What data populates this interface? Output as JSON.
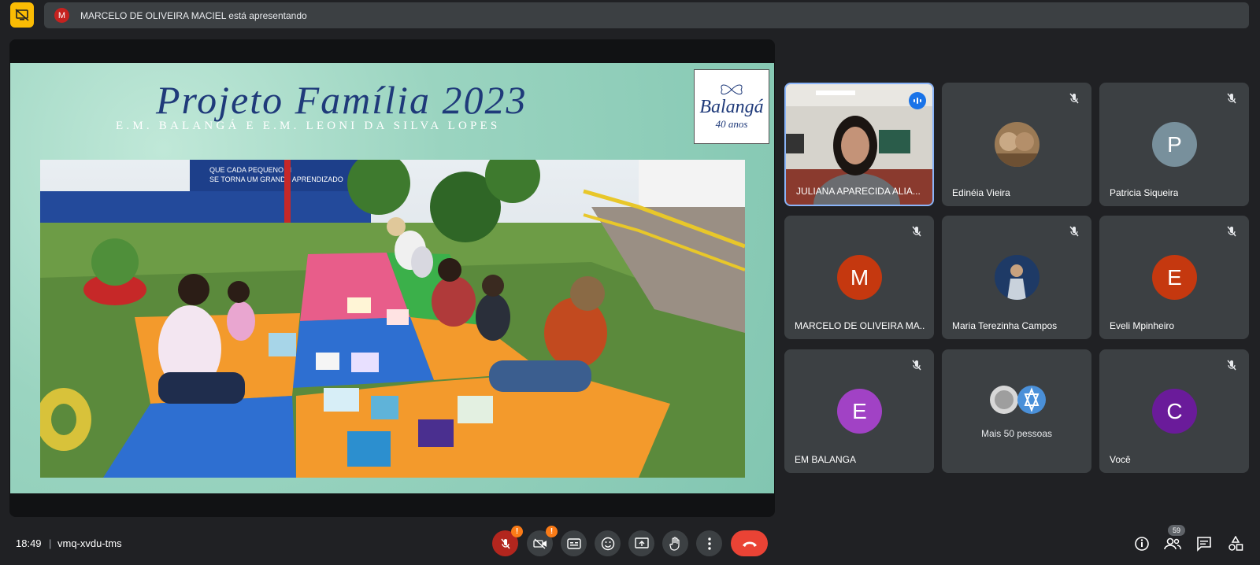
{
  "banner": {
    "avatar_letter": "M",
    "text": "MARCELO DE OLIVEIRA MACIEL está apresentando"
  },
  "slide": {
    "title": "Projeto Família 2023",
    "subtitle": "E.M. BALANGÁ E E.M. LEONI DA SILVA LOPES",
    "logo_main": "Balangá",
    "logo_years": "40 anos",
    "mural_text_1": "QUE CADA PEQUENO M",
    "mural_text_2": "SE TORNA UM GRANDE APRENDIZADO"
  },
  "participants": [
    {
      "name": "JULIANA APARECIDA ALIA...",
      "speaking": true
    },
    {
      "name": "Edinéia Vieira"
    },
    {
      "name": "Patricia Siqueira",
      "letter": "P",
      "color": "#78909c"
    },
    {
      "name": "MARCELO DE OLIVEIRA MA...",
      "letter": "M",
      "color": "#c5380f"
    },
    {
      "name": "Maria Terezinha Campos"
    },
    {
      "name": "Eveli Mpinheiro",
      "letter": "E",
      "color": "#c5380f"
    },
    {
      "name": "EM BALANGA",
      "letter": "E",
      "color": "#a142c5"
    },
    {
      "name": "Mais 50 pessoas"
    },
    {
      "name": "Você",
      "letter": "C",
      "color": "#6a1b9a"
    }
  ],
  "bottom": {
    "time": "18:49",
    "separator": "|",
    "meeting_code": "vmq-xvdu-tms",
    "mic_warning": "!",
    "cam_warning": "!",
    "people_count": "59"
  },
  "colors": {
    "accent": "#8ab4f8",
    "end_call": "#ea4335",
    "present_highlight": "#fbbc04"
  }
}
